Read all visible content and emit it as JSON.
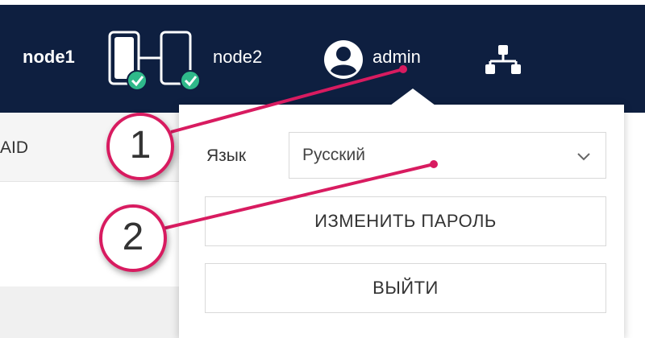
{
  "header": {
    "node1_label": "node1",
    "node2_label": "node2",
    "user_label": "admin"
  },
  "page": {
    "tab_fragment": "AID"
  },
  "user_menu": {
    "language_label": "Язык",
    "language_value": "Русский",
    "change_password_label": "ИЗМЕНИТЬ ПАРОЛЬ",
    "logout_label": "ВЫЙТИ"
  },
  "annotations": {
    "callout_1": "1",
    "callout_2": "2"
  },
  "colors": {
    "header_bg": "#0e1f40",
    "annotation": "#d81b60",
    "status_ok": "#2fb98a"
  },
  "icons": [
    "cluster-icon",
    "user-icon",
    "network-icon",
    "chevron-down-icon"
  ]
}
